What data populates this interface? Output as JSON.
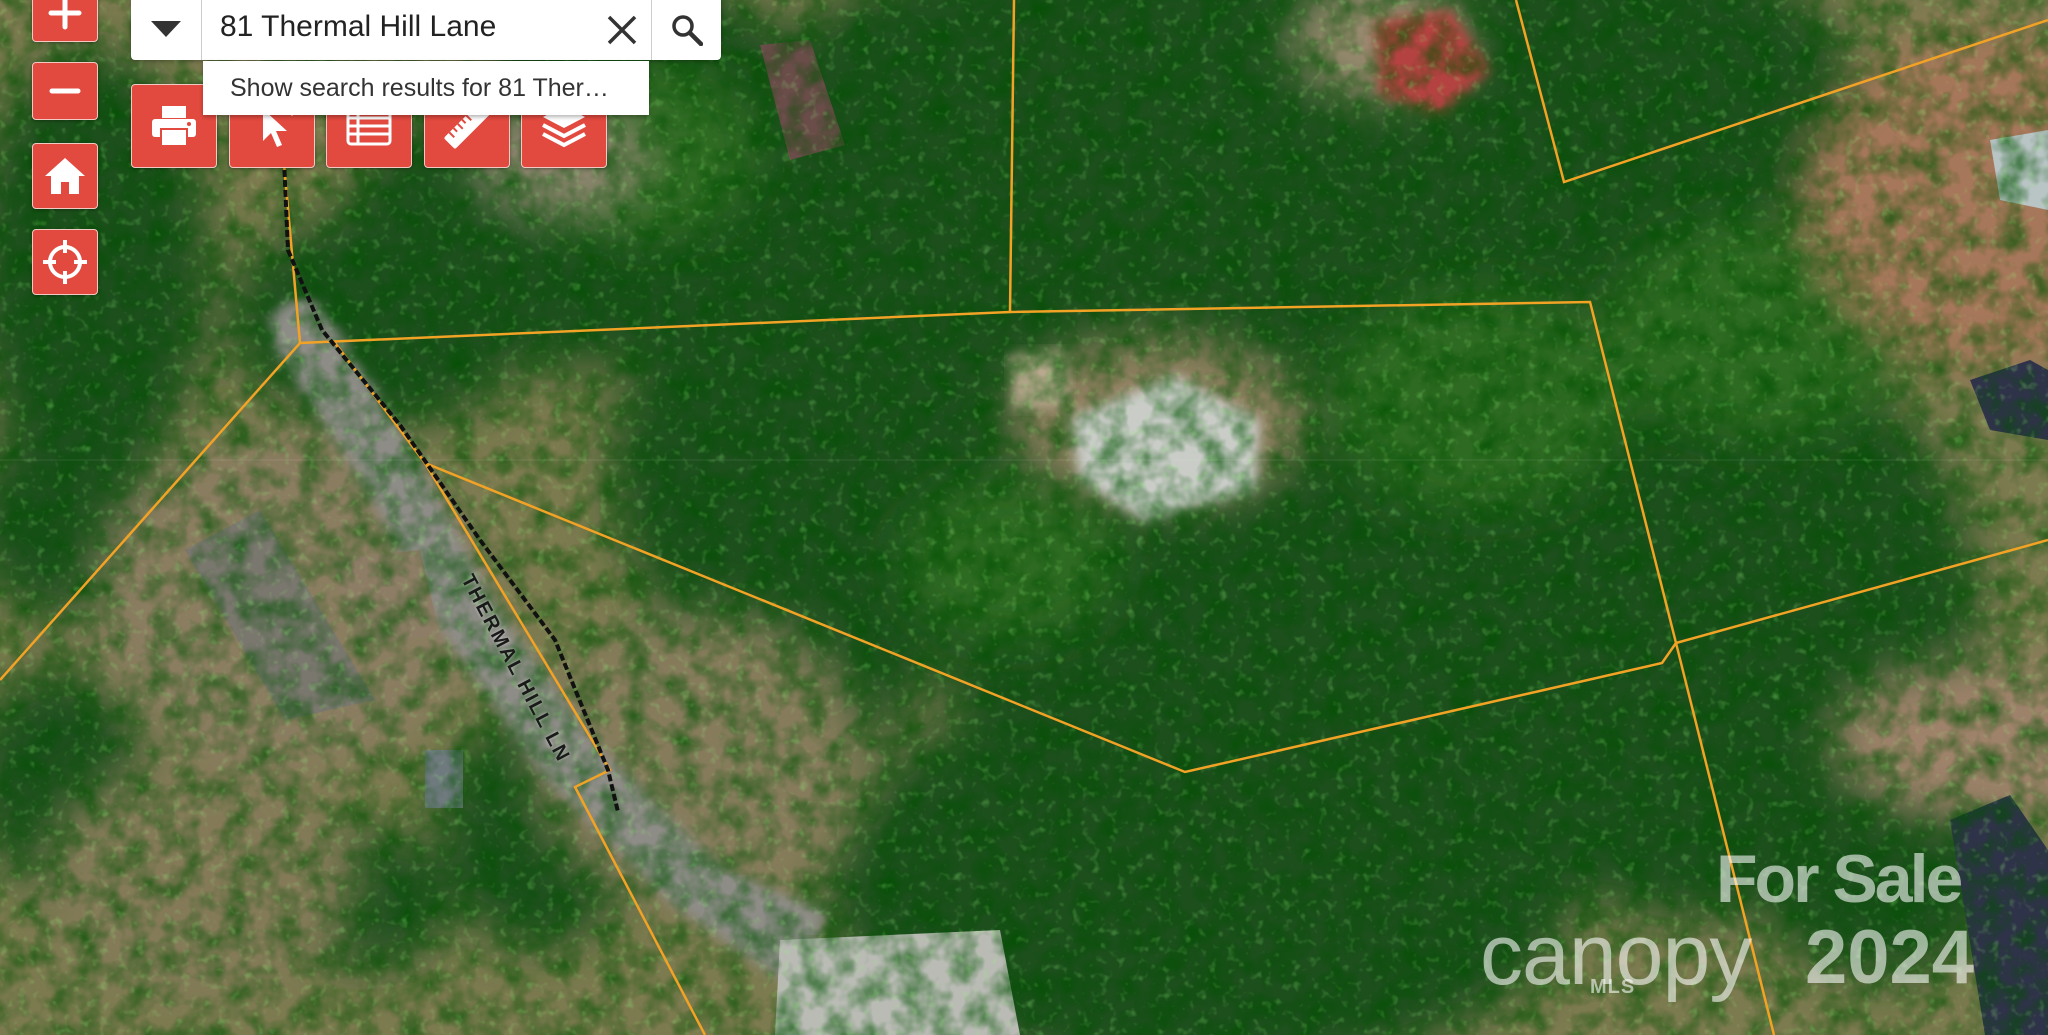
{
  "search": {
    "query": "81 Thermal Hill Lane",
    "suggestion": "Show search results for 81 Ther…"
  },
  "map": {
    "basemap": "satellite imagery",
    "parcel_line_color": "#f2a225",
    "road_color": "#111111",
    "road_label": "THERMAL HILL LN"
  },
  "controls": {
    "accent_color": "#e24a3f",
    "zoom": [
      "zoom-in-icon",
      "zoom-out-icon"
    ],
    "side": [
      "home-icon",
      "locate-icon"
    ],
    "toolbar": [
      "print-icon",
      "identify-icon",
      "table-icon",
      "measure-icon",
      "layers-icon"
    ]
  },
  "watermark": {
    "status": "For Sale",
    "brand": "canopy",
    "sub": "MLS",
    "year": "2024"
  }
}
